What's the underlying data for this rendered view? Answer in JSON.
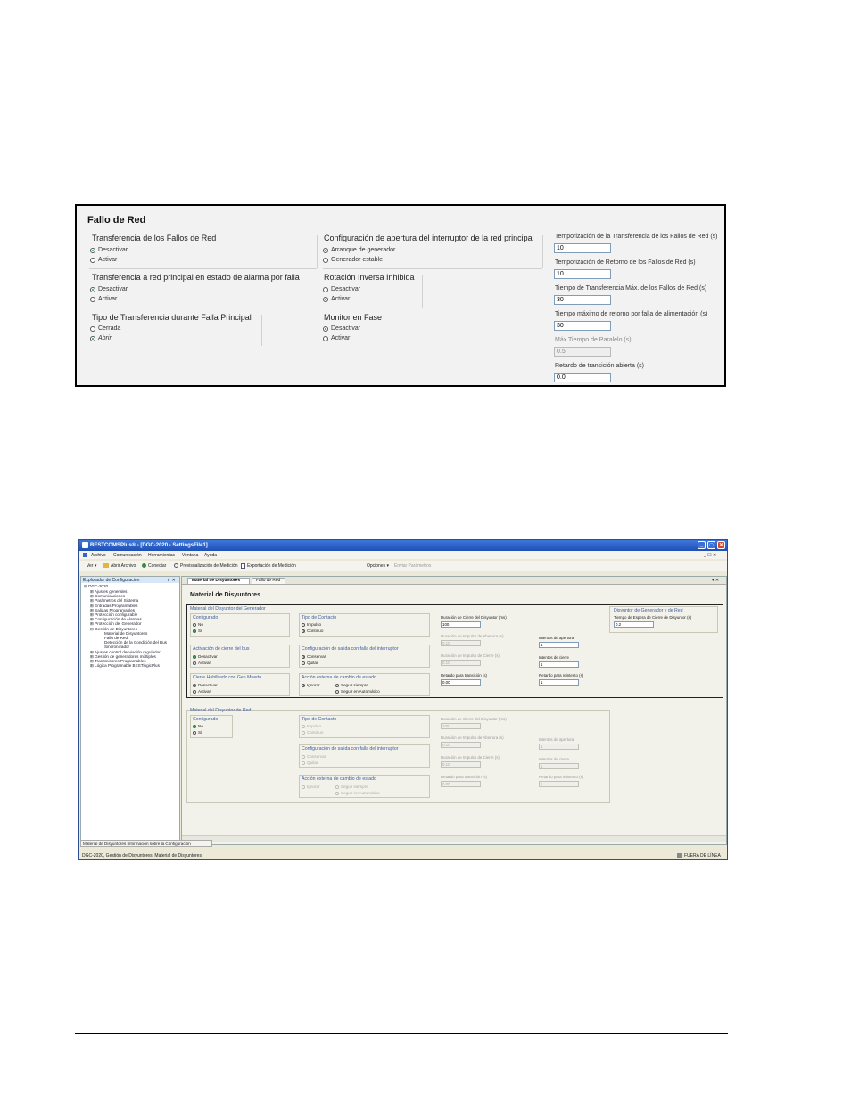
{
  "fallo_panel": {
    "title": "Fallo de Red",
    "groups": {
      "transferencia": {
        "title": "Transferencia de los Fallos de Red",
        "options": [
          "Desactivar",
          "Activar"
        ],
        "selected": 0
      },
      "alarma": {
        "title": "Transferencia a red principal en estado de alarma por falla",
        "options": [
          "Desactivar",
          "Activar"
        ],
        "selected": 0
      },
      "tipo": {
        "title": "Tipo de Transferencia durante Falla Principal",
        "options": [
          "Cerrada",
          "Abrir"
        ],
        "selected": 1
      },
      "apertura": {
        "title": "Configuración de apertura del interruptor de la red principal",
        "options": [
          "Arranque de generador",
          "Generador estable"
        ],
        "selected": 0
      },
      "rotacion": {
        "title": "Rotación Inversa Inhibida",
        "options": [
          "Desactivar",
          "Activar"
        ],
        "selected": 1
      },
      "monitor": {
        "title": "Monitor en Fase",
        "options": [
          "Desactivar",
          "Activar"
        ],
        "selected": 0
      }
    },
    "fields": [
      {
        "label": "Temporización de la Transferencia de los Fallos de Red (s)",
        "value": "10",
        "disabled": false
      },
      {
        "label": "Temporización de Retorno de los Fallos de Red (s)",
        "value": "10",
        "disabled": false
      },
      {
        "label": "Tiempo de Transferencia Máx. de los Fallos de Red (s)",
        "value": "30",
        "disabled": false
      },
      {
        "label": "Tiempo máximo de retorno por falla de alimentación (s)",
        "value": "30",
        "disabled": false
      },
      {
        "label": "Máx Tiempo de Paralelo (s)",
        "value": "0.5",
        "disabled": true
      },
      {
        "label": "Retardo de transición abierta (s)",
        "value": "0.0",
        "disabled": false
      }
    ]
  },
  "app": {
    "title": "BESTCOMSPlus® - [DGC-2020 - SettingsFile1]",
    "menu": [
      "Archivo",
      "Comunicación",
      "Herramientas",
      "Ventana",
      "Ayuda"
    ],
    "menu_right": "_ ☐ ✕",
    "toolbar": {
      "view": "Ver ▾",
      "open": "Abrir Archivo",
      "connect": "Conectar",
      "preview": "Previsualización de Medición",
      "export": "Exportación de Medición",
      "options": "Opciones ▾",
      "send": "Enviar Parámetros"
    },
    "sidebar": {
      "title": "Explorador de Configuración",
      "pin": "⇟ ✕",
      "root": "DGC-2020",
      "items": [
        "Ajustes generales",
        "Comunicaciones",
        "Parámetros del Sistema",
        "Entradas Programables",
        "Salidas Programables",
        "Protección configurable",
        "Configuración de Alarmas",
        "Protección del Generador",
        "Gestión de Disyuntores"
      ],
      "sub_items": [
        "Material de Disyuntores",
        "Fallo de Red",
        "Detección de la Condición del Bus",
        "Sincronizador"
      ],
      "tail_items": [
        "Ajustes control desviación regulador",
        "Gestión de generadores múltiples",
        "Transmisores Programables",
        "Lógica Programable BESTlogicPlus"
      ]
    },
    "tabs": [
      "Material de Disyuntores",
      "Fallo de Red"
    ],
    "tab_close": "▾ ✕",
    "page_title": "Material de Disyuntores",
    "gen": {
      "title": "Material del Disyuntor del Generador",
      "configurado": {
        "title": "Configurado",
        "options": [
          "No",
          "Sí"
        ],
        "selected": 1
      },
      "contacto": {
        "title": "Tipo de Contacto",
        "options": [
          "Impulso",
          "Continuo"
        ],
        "selected": 1
      },
      "activacion": {
        "title": "Activación de cierre del bus",
        "options": [
          "Desactivar",
          "Activar"
        ],
        "selected": 0
      },
      "salida": {
        "title": "Configuración de salida con falla del interruptor",
        "options": [
          "Conservar",
          "Quitar"
        ],
        "selected": 0
      },
      "cierre": {
        "title": "Cierre Habilitado con Gen Muerto",
        "options": [
          "Desactivar",
          "Activar"
        ],
        "selected": 0
      },
      "accion": {
        "title": "Acción externa de cambio de estado",
        "options": [
          "Ignorar",
          "Seguir siempre",
          "Seguir en Automático"
        ],
        "selected": 0
      },
      "fields": [
        {
          "label": "Duración de Cierre del Disyuntor (ms)",
          "value": "100",
          "disabled": false
        },
        {
          "label": "Duración de Impulso de Abertura (s)",
          "value": "0.10",
          "disabled": true
        },
        {
          "label": "Intentos de apertura",
          "value": "1",
          "disabled": false
        },
        {
          "label": "Duración de Impulso de Cierre (s)",
          "value": "0.10",
          "disabled": true
        },
        {
          "label": "Intentos de cierre",
          "value": "1",
          "disabled": false
        },
        {
          "label": "Retardo para transición (s)",
          "value": "0.00",
          "disabled": false
        },
        {
          "label": "Retardo para reintento (s)",
          "value": "1",
          "disabled": false
        }
      ]
    },
    "gen_red": {
      "title": "Disyuntor de Generador y de Red",
      "label": "Tiempo de Espera de Cierre de Disyuntor (s)",
      "value": "0.2"
    },
    "red": {
      "title": "Material del Disyuntor de Red",
      "configurado": {
        "title": "Configurado",
        "options": [
          "No",
          "Sí"
        ],
        "selected": 0
      },
      "contacto": {
        "title": "Tipo de Contacto",
        "options": [
          "Impulso",
          "Continuo"
        ],
        "selected": 1
      },
      "salida": {
        "title": "Configuración de salida con falla del interruptor",
        "options": [
          "Conservar",
          "Quitar"
        ],
        "selected": 0
      },
      "accion": {
        "title": "Acción externa de cambio de estado",
        "options": [
          "Ignorar",
          "Seguir siempre",
          "Seguir en Automático"
        ],
        "selected": 0
      },
      "fields": [
        {
          "label": "Duración de Cierre del Disyuntor (ms)",
          "value": "100",
          "disabled": true
        },
        {
          "label": "Duración de Impulso de Abertura (s)",
          "value": "0.10",
          "disabled": true
        },
        {
          "label": "Intentos de apertura",
          "value": "1",
          "disabled": true
        },
        {
          "label": "Duración de Impulso de Cierre (s)",
          "value": "0.10",
          "disabled": true
        },
        {
          "label": "Intentos de cierre",
          "value": "1",
          "disabled": true
        },
        {
          "label": "Retardo para transición (s)",
          "value": "0.00",
          "disabled": true
        },
        {
          "label": "Retardo para reintento (s)",
          "value": "1",
          "disabled": true
        }
      ]
    },
    "bottom_tab": "Material de Disyuntores Información sobre la Configuración",
    "status_left": "DGC-2020, Gestión de Disyuntores, Material de Disyuntores",
    "status_right": "FUERA DE LÍNEA"
  }
}
